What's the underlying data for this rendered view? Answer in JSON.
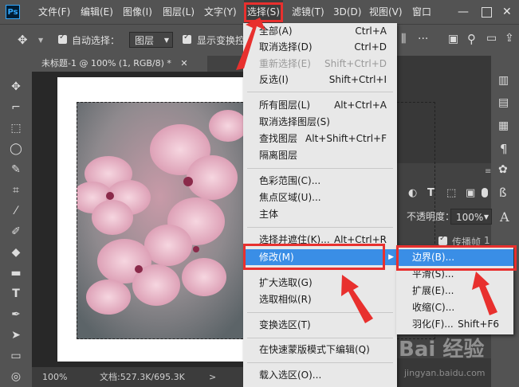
{
  "menubar": {
    "logo": "Ps",
    "items": [
      "文件(F)",
      "编辑(E)",
      "图像(I)",
      "图层(L)",
      "文字(Y)",
      "选择(S)",
      "滤镜(T)",
      "3D(D)",
      "视图(V)",
      "窗口"
    ]
  },
  "options": {
    "auto_select_label": "自动选择：",
    "auto_select_value": "图层",
    "show_transform_label": "显示变换控"
  },
  "document": {
    "tab_title": "未标题-1 @ 100% (1, RGB/8) *",
    "zoom": "100%",
    "doc_info": "文档:527.3K/695.3K"
  },
  "panel": {
    "opacity_label": "不透明度：",
    "opacity_value": "100%",
    "layer_name": "传播帧",
    "layer_num": "1"
  },
  "select_menu": [
    {
      "label": "全部(A)",
      "shortcut": "Ctrl+A",
      "disabled": false
    },
    {
      "label": "取消选择(D)",
      "shortcut": "Ctrl+D",
      "disabled": false
    },
    {
      "label": "重新选择(E)",
      "shortcut": "Shift+Ctrl+D",
      "disabled": true
    },
    {
      "label": "反选(I)",
      "shortcut": "Shift+Ctrl+I",
      "disabled": false
    },
    {
      "label": "所有图层(L)",
      "shortcut": "Alt+Ctrl+A",
      "disabled": false
    },
    {
      "label": "取消选择图层(S)",
      "shortcut": "",
      "disabled": false
    },
    {
      "label": "查找图层",
      "shortcut": "Alt+Shift+Ctrl+F",
      "disabled": false
    },
    {
      "label": "隔离图层",
      "shortcut": "",
      "disabled": false
    },
    {
      "label": "色彩范围(C)...",
      "shortcut": "",
      "disabled": false
    },
    {
      "label": "焦点区域(U)...",
      "shortcut": "",
      "disabled": false
    },
    {
      "label": "主体",
      "shortcut": "",
      "disabled": false
    },
    {
      "label": "选择并遮住(K)...",
      "shortcut": "Alt+Ctrl+R",
      "disabled": false
    },
    {
      "label": "修改(M)",
      "shortcut": "",
      "disabled": false
    },
    {
      "label": "扩大选取(G)",
      "shortcut": "",
      "disabled": false
    },
    {
      "label": "选取相似(R)",
      "shortcut": "",
      "disabled": false
    },
    {
      "label": "变换选区(T)",
      "shortcut": "",
      "disabled": false
    },
    {
      "label": "在快速蒙版模式下编辑(Q)",
      "shortcut": "",
      "disabled": false
    },
    {
      "label": "载入选区(O)...",
      "shortcut": "",
      "disabled": false
    }
  ],
  "modify_submenu": [
    {
      "label": "边界(B)...",
      "shortcut": ""
    },
    {
      "label": "平滑(S)...",
      "shortcut": ""
    },
    {
      "label": "扩展(E)...",
      "shortcut": ""
    },
    {
      "label": "收缩(C)...",
      "shortcut": ""
    },
    {
      "label": "羽化(F)...",
      "shortcut": "Shift+F6"
    }
  ],
  "watermark": {
    "text": "Bai 经验",
    "url": "jingyan.baidu.com"
  },
  "colors": {
    "highlight": "#3a8ee6",
    "annotation_red": "#e8302e"
  }
}
